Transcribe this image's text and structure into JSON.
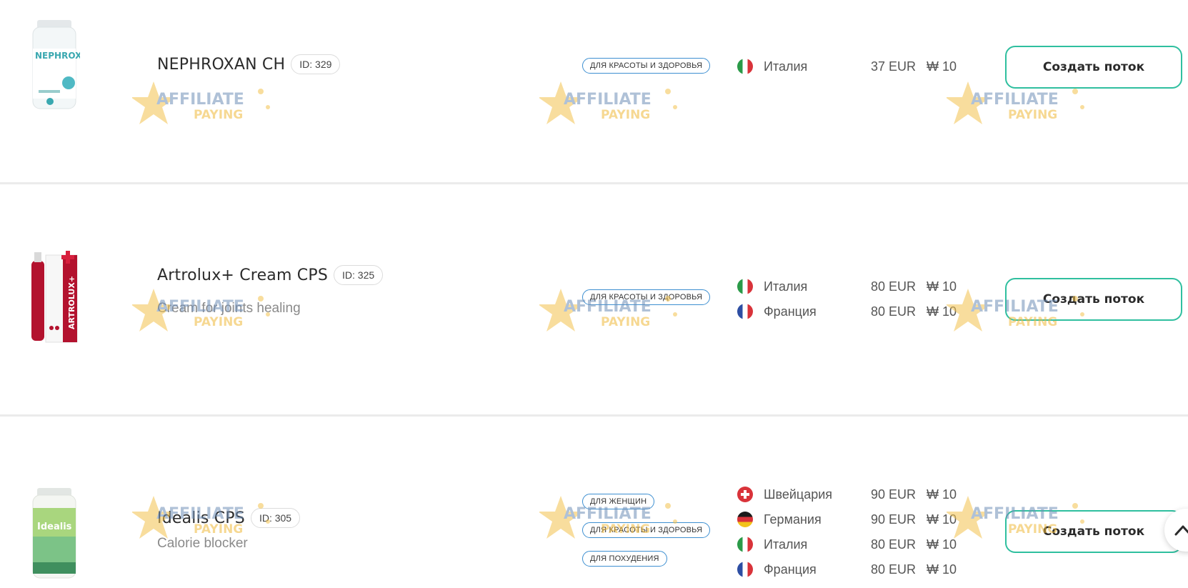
{
  "products": [
    {
      "name": "NEPHROXAN CH",
      "id_label": "ID: 329",
      "description": "",
      "image_label": "NEPHROXAN",
      "tags": [
        "ДЛЯ КРАСОТЫ И ЗДОРОВЬЯ"
      ],
      "geos": [
        {
          "flag": "italy-flag-icon",
          "country": "Италия",
          "payout": "37 EUR",
          "bonus": "₩ 10"
        }
      ],
      "button_label": "Создать поток"
    },
    {
      "name": "Artrolux+ Cream CPS",
      "id_label": "ID: 325",
      "description": "Cream for joints healing",
      "image_label": "ARTROLUX+",
      "tags": [
        "ДЛЯ КРАСОТЫ И ЗДОРОВЬЯ"
      ],
      "geos": [
        {
          "flag": "italy-flag-icon",
          "country": "Италия",
          "payout": "80 EUR",
          "bonus": "₩ 10"
        },
        {
          "flag": "france-flag-icon",
          "country": "Франция",
          "payout": "80 EUR",
          "bonus": "₩ 10"
        }
      ],
      "button_label": "Создать поток"
    },
    {
      "name": "Idealis CPS",
      "id_label": "ID: 305",
      "description": "Calorie blocker",
      "image_label": "Idealis",
      "tags": [
        "ДЛЯ ЖЕНЩИН",
        "ДЛЯ КРАСОТЫ И ЗДОРОВЬЯ",
        "ДЛЯ ПОХУДЕНИЯ"
      ],
      "geos": [
        {
          "flag": "switzerland-flag-icon",
          "country": "Швейцария",
          "payout": "90 EUR",
          "bonus": "₩ 10"
        },
        {
          "flag": "germany-flag-icon",
          "country": "Германия",
          "payout": "90 EUR",
          "bonus": "₩ 10"
        },
        {
          "flag": "italy-flag-icon",
          "country": "Италия",
          "payout": "80 EUR",
          "bonus": "₩ 10"
        },
        {
          "flag": "france-flag-icon",
          "country": "Франция",
          "payout": "80 EUR",
          "bonus": "₩ 10"
        }
      ],
      "button_label": "Создать поток"
    }
  ],
  "watermark": {
    "line1": "AFFILIATE",
    "line2": "PAYING"
  },
  "colors": {
    "button_border": "#2fbf9f",
    "tag_border": "#3d8fd1",
    "divider": "#ebebeb"
  },
  "icons": {
    "scroll_top": "chevron-up-icon"
  }
}
